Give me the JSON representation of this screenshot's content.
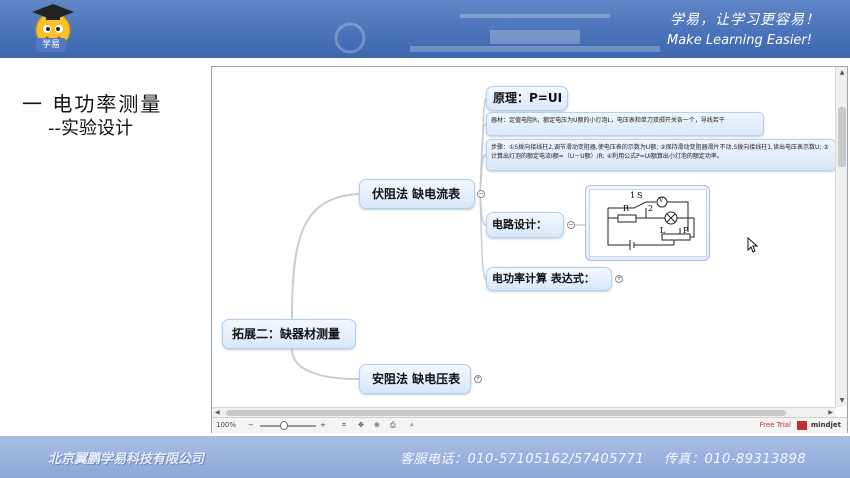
{
  "header": {
    "logo_text": "学易",
    "slogan_cn": "学易，让学习更容易！",
    "slogan_en": "Make Learning Easier!"
  },
  "slide": {
    "title": "一 电功率测量",
    "subtitle": "--实验设计"
  },
  "mindmap": {
    "central": "拓展二：缺器材测量",
    "branch_voltammeter": "伏阻法 缺电流表",
    "branch_ammeter": "安阻法 缺电压表",
    "principle": "原理：P=UI",
    "equipment_note": "器材：定值电阻R，额定电压为U额的小灯泡L，电压表和单刀双掷开关各一个，导线若干",
    "steps_note": "步骤：①S拨向接线柱2,调节滑动变阻器,使电压表的示数为U额; ②保持滑动变阻器滑片不动,S拨向接线柱1,读出电压表示数U; ③计算出灯泡的额定电流I额=（U－U额）/R; ④利用公式P=UI额算出小灯泡的额定功率。",
    "circuit_design": "电路设计：",
    "power_formula": "电功率计算 表达式：",
    "circuit_labels": {
      "s1": "1",
      "s": "S",
      "v": "V",
      "two": "2",
      "r": "R",
      "l": "L",
      "p": "P"
    },
    "collapse_minus": "−",
    "expand_plus": "+"
  },
  "statusbar": {
    "zoom": "100%",
    "minus": "−",
    "plus": "+",
    "free_trial": "Free Trial",
    "brand": "mindjet"
  },
  "footer": {
    "company": "北京翼鹏学易科技有限公司",
    "service": "客服电话：010-57105162/57405771",
    "fax": "传真：010-89313898"
  },
  "colors": {
    "banner": "#4a72b8",
    "footer": "#9fb4e0",
    "topic_fill": "#d7e8fa",
    "topic_border": "#b6cfe9"
  }
}
